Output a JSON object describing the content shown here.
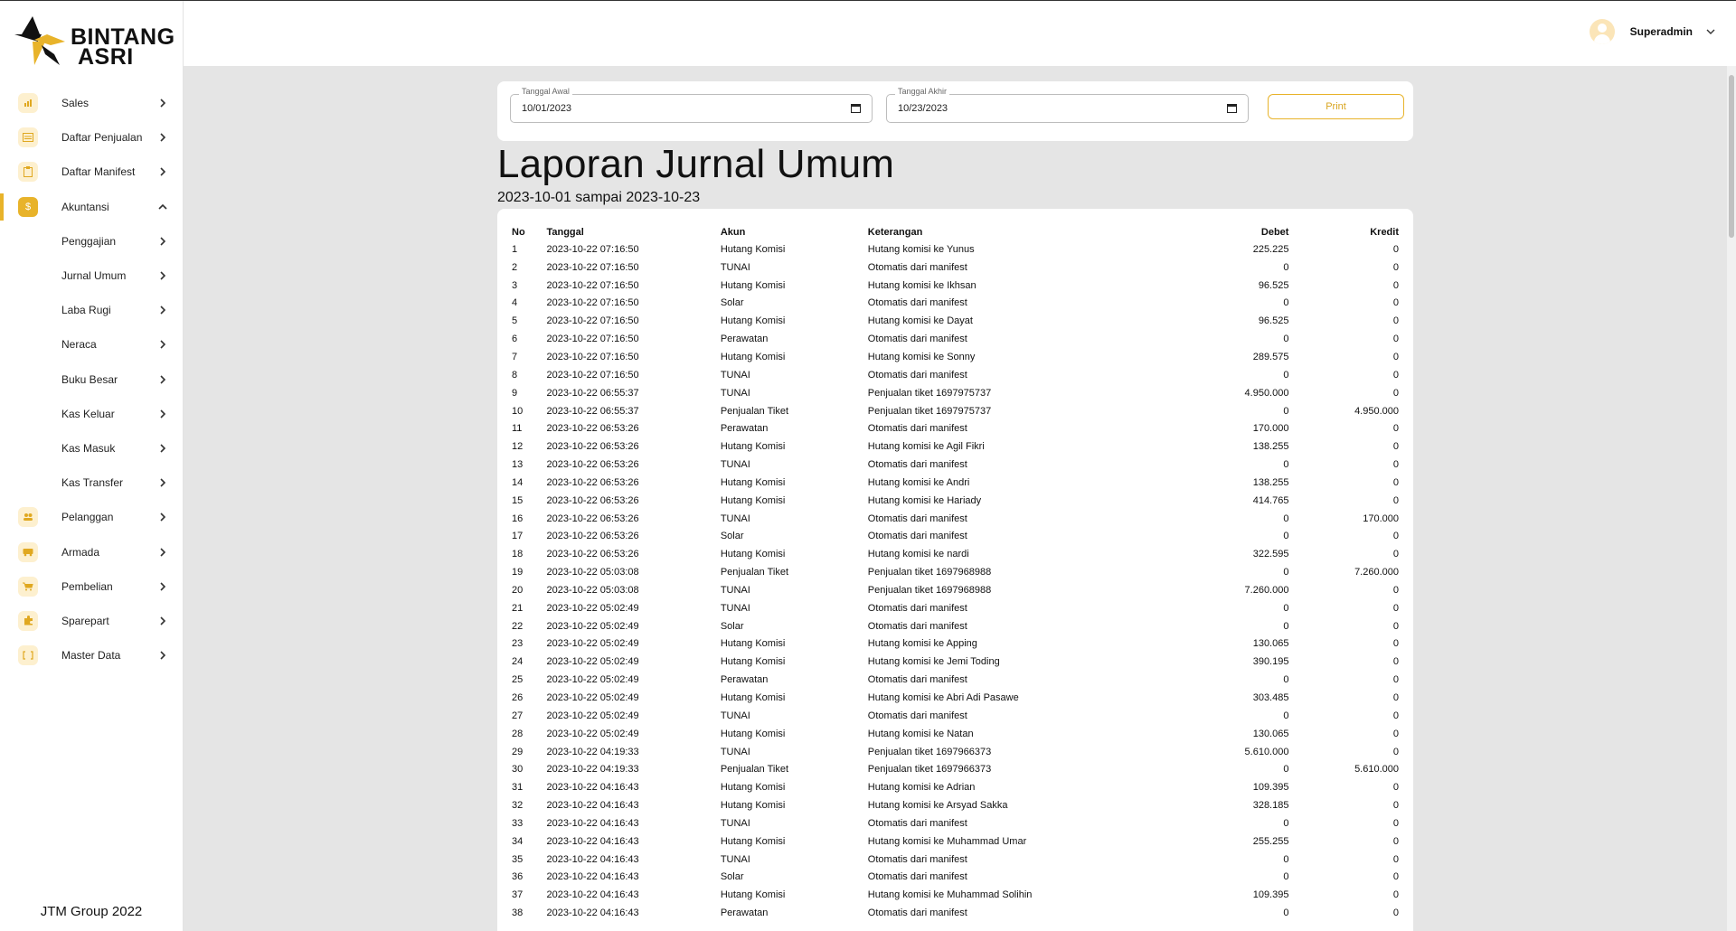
{
  "brand": {
    "line1": "BINTANG",
    "line2": "ASRI"
  },
  "sidebar": {
    "items": [
      {
        "label": "Sales",
        "icon": "chart-icon",
        "glyph": "▮"
      },
      {
        "label": "Daftar Penjualan",
        "icon": "list-icon",
        "glyph": "▤"
      },
      {
        "label": "Daftar Manifest",
        "icon": "clipboard-icon",
        "glyph": "▢"
      },
      {
        "label": "Akuntansi",
        "icon": "dollar-icon",
        "glyph": "$"
      }
    ],
    "sub_items": [
      "Penggajian",
      "Jurnal Umum",
      "Laba Rugi",
      "Neraca",
      "Buku Besar",
      "Kas Keluar",
      "Kas Masuk",
      "Kas Transfer"
    ],
    "items_bottom": [
      {
        "label": "Pelanggan",
        "icon": "people-icon",
        "glyph": "◉"
      },
      {
        "label": "Armada",
        "icon": "bus-icon",
        "glyph": "▬"
      },
      {
        "label": "Pembelian",
        "icon": "cart-icon",
        "glyph": "◤"
      },
      {
        "label": "Sparepart",
        "icon": "puzzle-icon",
        "glyph": "✚"
      },
      {
        "label": "Master Data",
        "icon": "bracket-icon",
        "glyph": "[ ]"
      }
    ],
    "footer": "JTM Group 2022"
  },
  "header": {
    "user_name": "Superadmin"
  },
  "filter": {
    "start_label": "Tanggal Awal",
    "start_value": "10/01/2023",
    "end_label": "Tanggal Akhir",
    "end_value": "10/23/2023",
    "print_label": "Print"
  },
  "report": {
    "title": "Laporan Jurnal Umum",
    "subtitle": "2023-10-01 sampai 2023-10-23"
  },
  "table": {
    "headers": {
      "no": "No",
      "tanggal": "Tanggal",
      "akun": "Akun",
      "keterangan": "Keterangan",
      "debet": "Debet",
      "kredit": "Kredit"
    },
    "rows": [
      [
        "1",
        "2023-10-22 07:16:50",
        "Hutang Komisi",
        "Hutang komisi ke Yunus",
        "225.225",
        "0"
      ],
      [
        "2",
        "2023-10-22 07:16:50",
        "TUNAI",
        "Otomatis dari manifest",
        "0",
        "0"
      ],
      [
        "3",
        "2023-10-22 07:16:50",
        "Hutang Komisi",
        "Hutang komisi ke Ikhsan",
        "96.525",
        "0"
      ],
      [
        "4",
        "2023-10-22 07:16:50",
        "Solar",
        "Otomatis dari manifest",
        "0",
        "0"
      ],
      [
        "5",
        "2023-10-22 07:16:50",
        "Hutang Komisi",
        "Hutang komisi ke Dayat",
        "96.525",
        "0"
      ],
      [
        "6",
        "2023-10-22 07:16:50",
        "Perawatan",
        "Otomatis dari manifest",
        "0",
        "0"
      ],
      [
        "7",
        "2023-10-22 07:16:50",
        "Hutang Komisi",
        "Hutang komisi ke Sonny",
        "289.575",
        "0"
      ],
      [
        "8",
        "2023-10-22 07:16:50",
        "TUNAI",
        "Otomatis dari manifest",
        "0",
        "0"
      ],
      [
        "9",
        "2023-10-22 06:55:37",
        "TUNAI",
        "Penjualan tiket 1697975737",
        "4.950.000",
        "0"
      ],
      [
        "10",
        "2023-10-22 06:55:37",
        "Penjualan Tiket",
        "Penjualan tiket 1697975737",
        "0",
        "4.950.000"
      ],
      [
        "11",
        "2023-10-22 06:53:26",
        "Perawatan",
        "Otomatis dari manifest",
        "170.000",
        "0"
      ],
      [
        "12",
        "2023-10-22 06:53:26",
        "Hutang Komisi",
        "Hutang komisi ke Agil Fikri",
        "138.255",
        "0"
      ],
      [
        "13",
        "2023-10-22 06:53:26",
        "TUNAI",
        "Otomatis dari manifest",
        "0",
        "0"
      ],
      [
        "14",
        "2023-10-22 06:53:26",
        "Hutang Komisi",
        "Hutang komisi ke Andri",
        "138.255",
        "0"
      ],
      [
        "15",
        "2023-10-22 06:53:26",
        "Hutang Komisi",
        "Hutang komisi ke Hariady",
        "414.765",
        "0"
      ],
      [
        "16",
        "2023-10-22 06:53:26",
        "TUNAI",
        "Otomatis dari manifest",
        "0",
        "170.000"
      ],
      [
        "17",
        "2023-10-22 06:53:26",
        "Solar",
        "Otomatis dari manifest",
        "0",
        "0"
      ],
      [
        "18",
        "2023-10-22 06:53:26",
        "Hutang Komisi",
        "Hutang komisi ke nardi",
        "322.595",
        "0"
      ],
      [
        "19",
        "2023-10-22 05:03:08",
        "Penjualan Tiket",
        "Penjualan tiket 1697968988",
        "0",
        "7.260.000"
      ],
      [
        "20",
        "2023-10-22 05:03:08",
        "TUNAI",
        "Penjualan tiket 1697968988",
        "7.260.000",
        "0"
      ],
      [
        "21",
        "2023-10-22 05:02:49",
        "TUNAI",
        "Otomatis dari manifest",
        "0",
        "0"
      ],
      [
        "22",
        "2023-10-22 05:02:49",
        "Solar",
        "Otomatis dari manifest",
        "0",
        "0"
      ],
      [
        "23",
        "2023-10-22 05:02:49",
        "Hutang Komisi",
        "Hutang komisi ke Apping",
        "130.065",
        "0"
      ],
      [
        "24",
        "2023-10-22 05:02:49",
        "Hutang Komisi",
        "Hutang komisi ke Jemi Toding",
        "390.195",
        "0"
      ],
      [
        "25",
        "2023-10-22 05:02:49",
        "Perawatan",
        "Otomatis dari manifest",
        "0",
        "0"
      ],
      [
        "26",
        "2023-10-22 05:02:49",
        "Hutang Komisi",
        "Hutang komisi ke Abri Adi Pasawe",
        "303.485",
        "0"
      ],
      [
        "27",
        "2023-10-22 05:02:49",
        "TUNAI",
        "Otomatis dari manifest",
        "0",
        "0"
      ],
      [
        "28",
        "2023-10-22 05:02:49",
        "Hutang Komisi",
        "Hutang komisi ke Natan",
        "130.065",
        "0"
      ],
      [
        "29",
        "2023-10-22 04:19:33",
        "TUNAI",
        "Penjualan tiket 1697966373",
        "5.610.000",
        "0"
      ],
      [
        "30",
        "2023-10-22 04:19:33",
        "Penjualan Tiket",
        "Penjualan tiket 1697966373",
        "0",
        "5.610.000"
      ],
      [
        "31",
        "2023-10-22 04:16:43",
        "Hutang Komisi",
        "Hutang komisi ke Adrian",
        "109.395",
        "0"
      ],
      [
        "32",
        "2023-10-22 04:16:43",
        "Hutang Komisi",
        "Hutang komisi ke Arsyad Sakka",
        "328.185",
        "0"
      ],
      [
        "33",
        "2023-10-22 04:16:43",
        "TUNAI",
        "Otomatis dari manifest",
        "0",
        "0"
      ],
      [
        "34",
        "2023-10-22 04:16:43",
        "Hutang Komisi",
        "Hutang komisi ke Muhammad Umar",
        "255.255",
        "0"
      ],
      [
        "35",
        "2023-10-22 04:16:43",
        "TUNAI",
        "Otomatis dari manifest",
        "0",
        "0"
      ],
      [
        "36",
        "2023-10-22 04:16:43",
        "Solar",
        "Otomatis dari manifest",
        "0",
        "0"
      ],
      [
        "37",
        "2023-10-22 04:16:43",
        "Hutang Komisi",
        "Hutang komisi ke Muhammad Solihin",
        "109.395",
        "0"
      ],
      [
        "38",
        "2023-10-22 04:16:43",
        "Perawatan",
        "Otomatis dari manifest",
        "0",
        "0"
      ]
    ]
  },
  "colors": {
    "accent": "#e8b32a",
    "accent_light": "#fdf0cf",
    "background": "#e5e5e5"
  }
}
